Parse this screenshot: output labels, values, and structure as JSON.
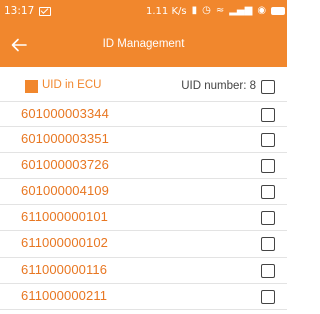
{
  "status_bar": {
    "time": "13:17",
    "net_speed": "1.11 K/s",
    "battery_pct": "93"
  },
  "app_bar": {
    "title": "ID Management"
  },
  "header": {
    "label": "UID in ECU",
    "uid_count": "UID number: 8"
  },
  "uids": [
    {
      "id": "601000003344",
      "checked": false
    },
    {
      "id": "601000003351",
      "checked": false
    },
    {
      "id": "601000003726",
      "checked": false
    },
    {
      "id": "601000004109",
      "checked": false
    },
    {
      "id": "611000000101",
      "checked": false
    },
    {
      "id": "611000000102",
      "checked": false
    },
    {
      "id": "611000000116",
      "checked": false
    },
    {
      "id": "611000000211",
      "checked": false
    }
  ],
  "colors": {
    "accent": "#f1872d",
    "uid_text": "#e87722"
  }
}
